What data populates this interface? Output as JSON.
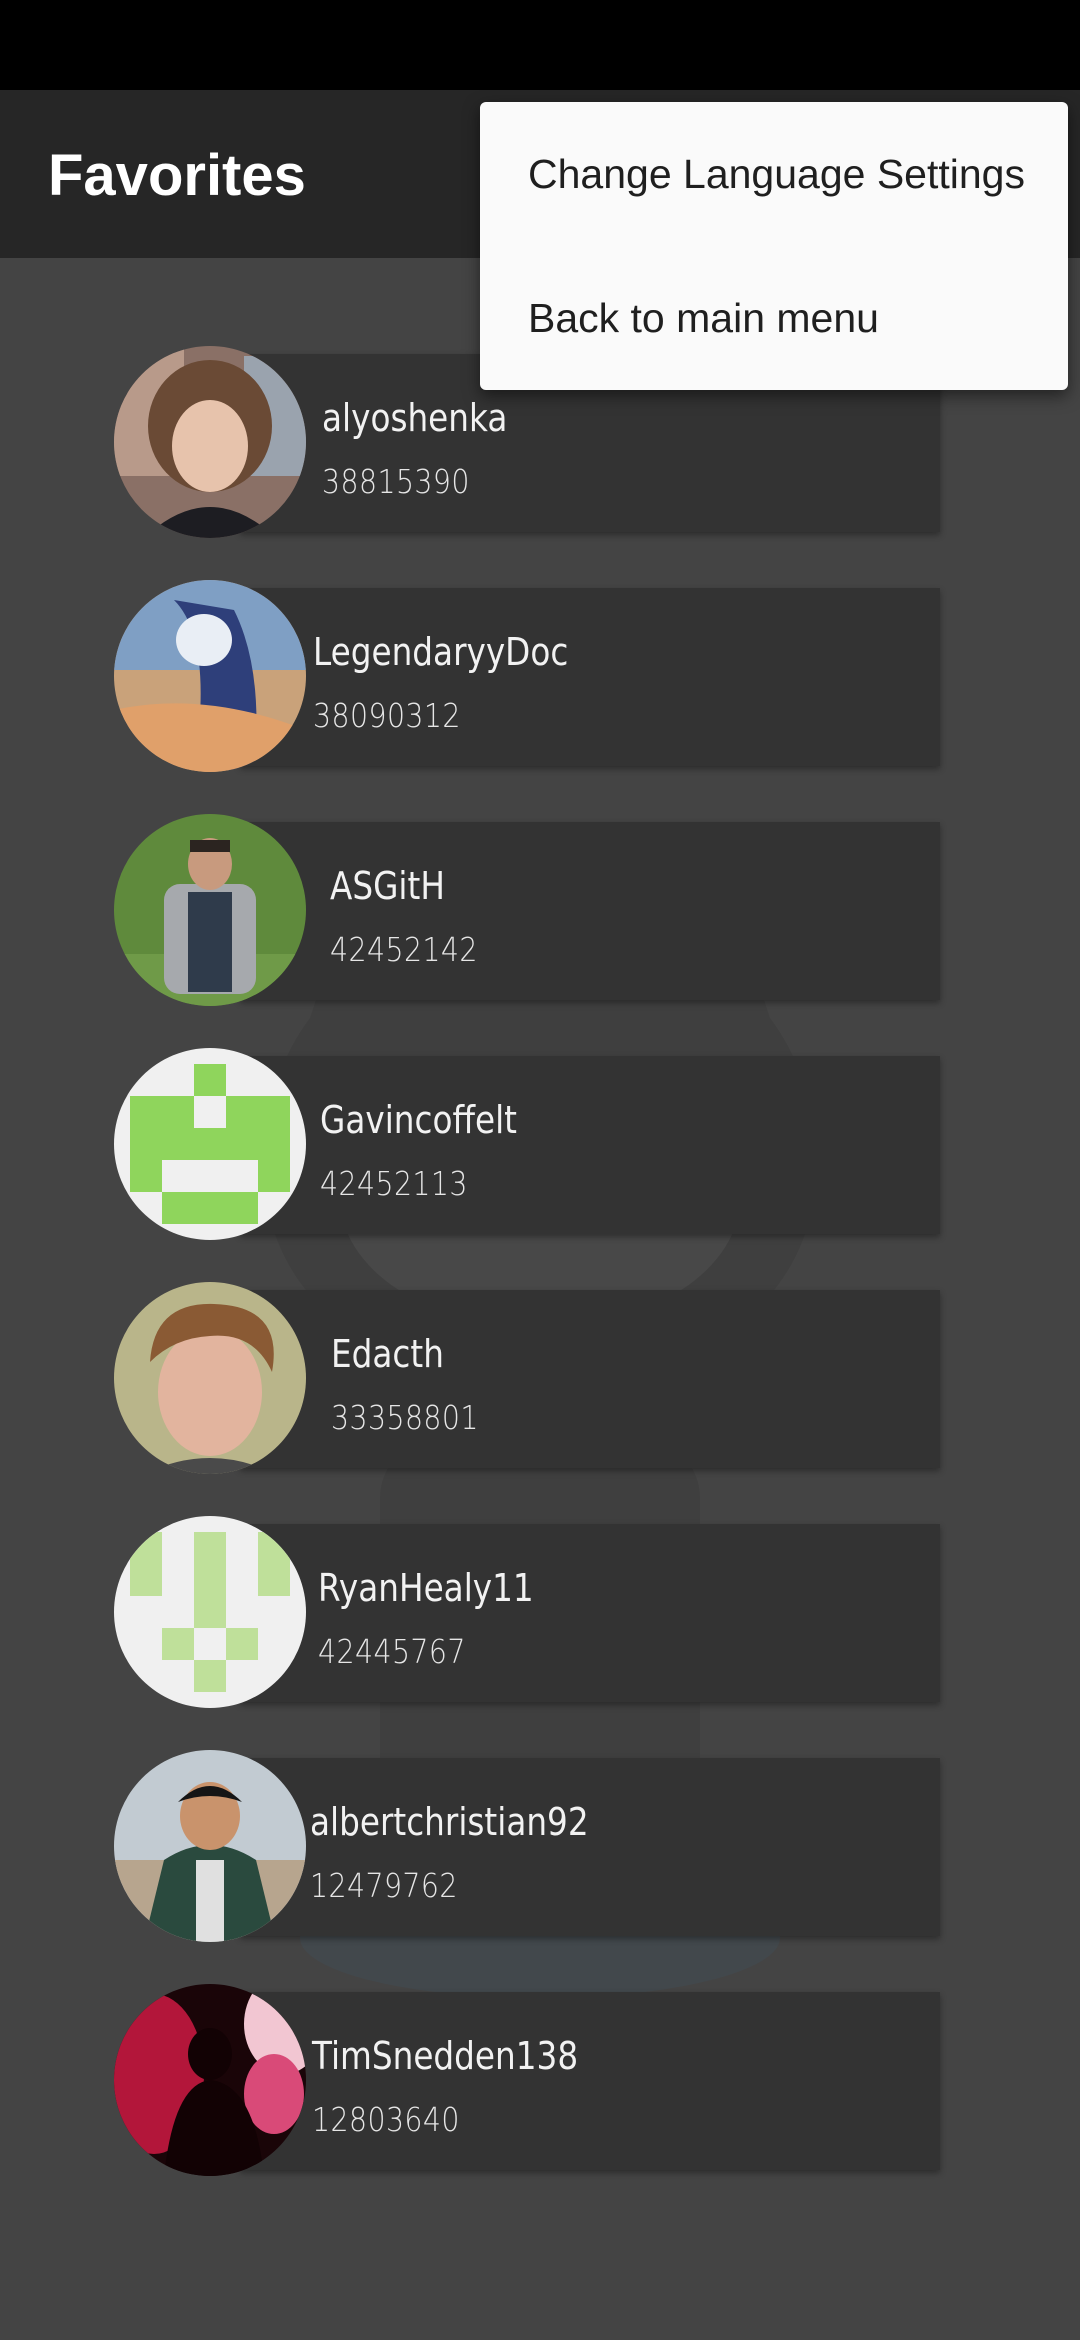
{
  "app_bar": {
    "title": "Favorites"
  },
  "overflow_menu": {
    "items": [
      {
        "label": "Change Language Settings"
      },
      {
        "label": "Back to main menu"
      }
    ]
  },
  "favorites": [
    {
      "username": "alyoshenka",
      "id": "38815390"
    },
    {
      "username": "LegendaryyDoc",
      "id": "38090312"
    },
    {
      "username": "ASGitH",
      "id": "42452142"
    },
    {
      "username": "Gavincoffelt",
      "id": "42452113"
    },
    {
      "username": "Edacth",
      "id": "33358801"
    },
    {
      "username": "RyanHealy11",
      "id": "42445767"
    },
    {
      "username": "albertchristian92",
      "id": "12479762"
    },
    {
      "username": "TimSnedden138",
      "id": "12803640"
    }
  ],
  "colors": {
    "status_bar": "#000000",
    "app_bar": "#262626",
    "background": "#444444",
    "card": "#333333",
    "menu": "#fafafa",
    "identicon_green": "#8fd55c",
    "identicon_light_green": "#bfe09a"
  }
}
